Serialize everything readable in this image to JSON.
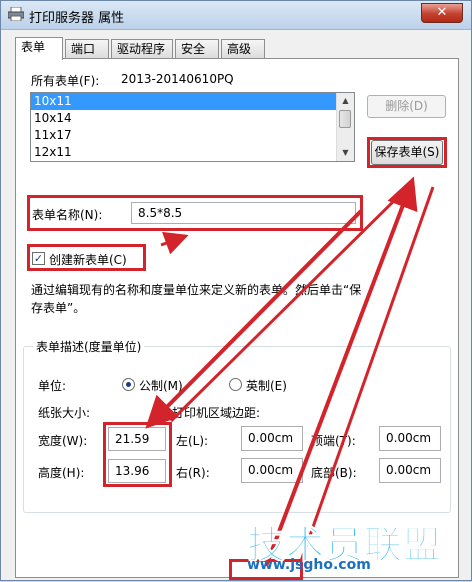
{
  "window": {
    "title": "打印服务器 属性",
    "close_glyph": "✕"
  },
  "tabs": [
    "表单",
    "端口",
    "驱动程序",
    "安全",
    "高级"
  ],
  "forms": {
    "all_forms_label": "所有表单(F):",
    "server_name": "2013-20140610PQ",
    "list": [
      "10x11",
      "10x14",
      "11x17",
      "12x11"
    ],
    "delete_label": "删除(D)",
    "save_label": "保存表单(S)"
  },
  "form_name": {
    "label": "表单名称(N):",
    "value": "8.5*8.5"
  },
  "create_new": {
    "label": "创建新表单(C)",
    "checked": true
  },
  "description": "通过编辑现有的名称和度量单位来定义新的表单。然后单击“保存表单”。",
  "group": {
    "title": "表单描述(度量单位)",
    "unit_label": "单位:",
    "metric_label": "公制(M)",
    "english_label": "英制(E)",
    "paper_size_label": "纸张大小:",
    "margins_label": "打印机区域边距:",
    "width_label": "宽度(W):",
    "width_value": "21.59",
    "height_label": "高度(H):",
    "height_value": "13.96",
    "left_label": "左(L):",
    "left_value": "0.00cm",
    "right_label": "右(R):",
    "right_value": "0.00cm",
    "top_label": "顶端(T):",
    "top_value": "0.00cm",
    "bottom_label": "底部(B):",
    "bottom_value": "0.00cm"
  },
  "watermark": {
    "text": "技术员联盟",
    "url": "www.jsgho.com"
  },
  "colors": {
    "annotation": "#d4242b",
    "selection": "#3399ff",
    "watermark": "#2fb8e8"
  }
}
